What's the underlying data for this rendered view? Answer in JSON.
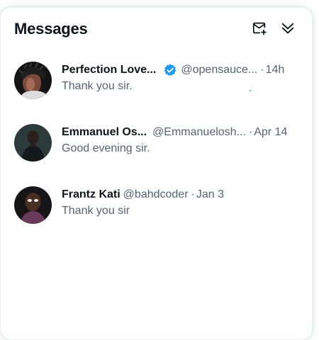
{
  "drawer": {
    "title": "Messages",
    "compose_icon": "new-message-icon",
    "collapse_icon": "double-chevron-down-icon"
  },
  "conversations": [
    {
      "name": "Perfection Love...",
      "verified": true,
      "handle": "@opensauce...",
      "separator": "·",
      "date": "14h",
      "preview": "Thank you sir."
    },
    {
      "name": "Emmanuel Os...",
      "verified": false,
      "handle": "@Emmanuelosh...",
      "separator": "·",
      "date": "Apr 14",
      "preview": "Good evening sir."
    },
    {
      "name": "Frantz Kati",
      "verified": false,
      "handle": "@bahdcoder",
      "separator": "·",
      "date": "Jan 3",
      "preview": "Thank you sir"
    }
  ],
  "colors": {
    "text_primary": "#0f1419",
    "text_secondary": "#536471",
    "verified_blue": "#1d9bf0"
  }
}
